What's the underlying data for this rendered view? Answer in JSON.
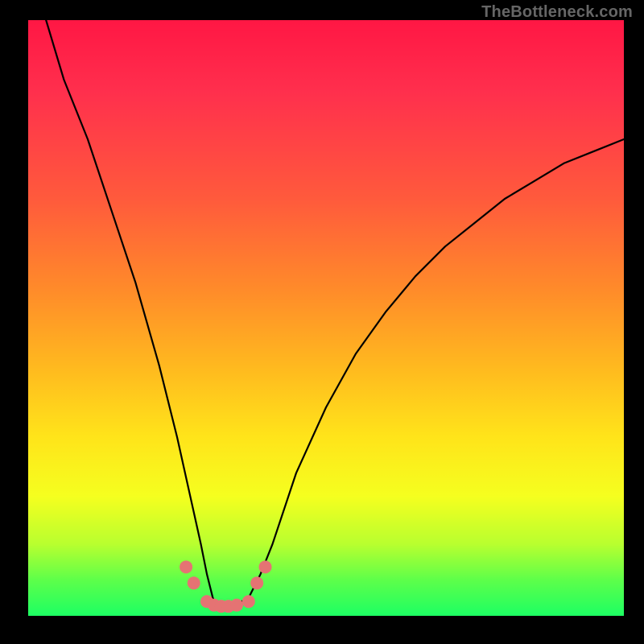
{
  "watermark_text": "TheBottleneck.com",
  "chart_data": {
    "type": "line",
    "title": "",
    "xlabel": "",
    "ylabel": "",
    "xlim": [
      0,
      100
    ],
    "ylim": [
      0,
      100
    ],
    "x": [
      3,
      6,
      10,
      14,
      18,
      22,
      25,
      27,
      29,
      30,
      31,
      32,
      33,
      35,
      37,
      39,
      41,
      43,
      45,
      50,
      55,
      60,
      65,
      70,
      75,
      80,
      85,
      90,
      95,
      100
    ],
    "values": [
      100,
      90,
      80,
      68,
      56,
      42,
      30,
      21,
      12,
      7,
      3,
      1,
      1,
      2,
      3,
      7,
      12,
      18,
      24,
      35,
      44,
      51,
      57,
      62,
      66,
      70,
      73,
      76,
      78,
      80
    ],
    "markers": {
      "color": "#e57373",
      "points_x": [
        26.5,
        27.8,
        30.0,
        31.2,
        32.4,
        33.6,
        35.0,
        37.0,
        38.4,
        39.8
      ],
      "points_y": [
        8.2,
        5.5,
        2.4,
        1.8,
        1.6,
        1.6,
        1.8,
        2.4,
        5.5,
        8.2
      ]
    },
    "gradient_stops": [
      {
        "pos": 0,
        "color": "#ff1744"
      },
      {
        "pos": 30,
        "color": "#ff5a3c"
      },
      {
        "pos": 58,
        "color": "#ffb81f"
      },
      {
        "pos": 80,
        "color": "#f5ff1f"
      },
      {
        "pos": 100,
        "color": "#1dff63"
      }
    ]
  }
}
